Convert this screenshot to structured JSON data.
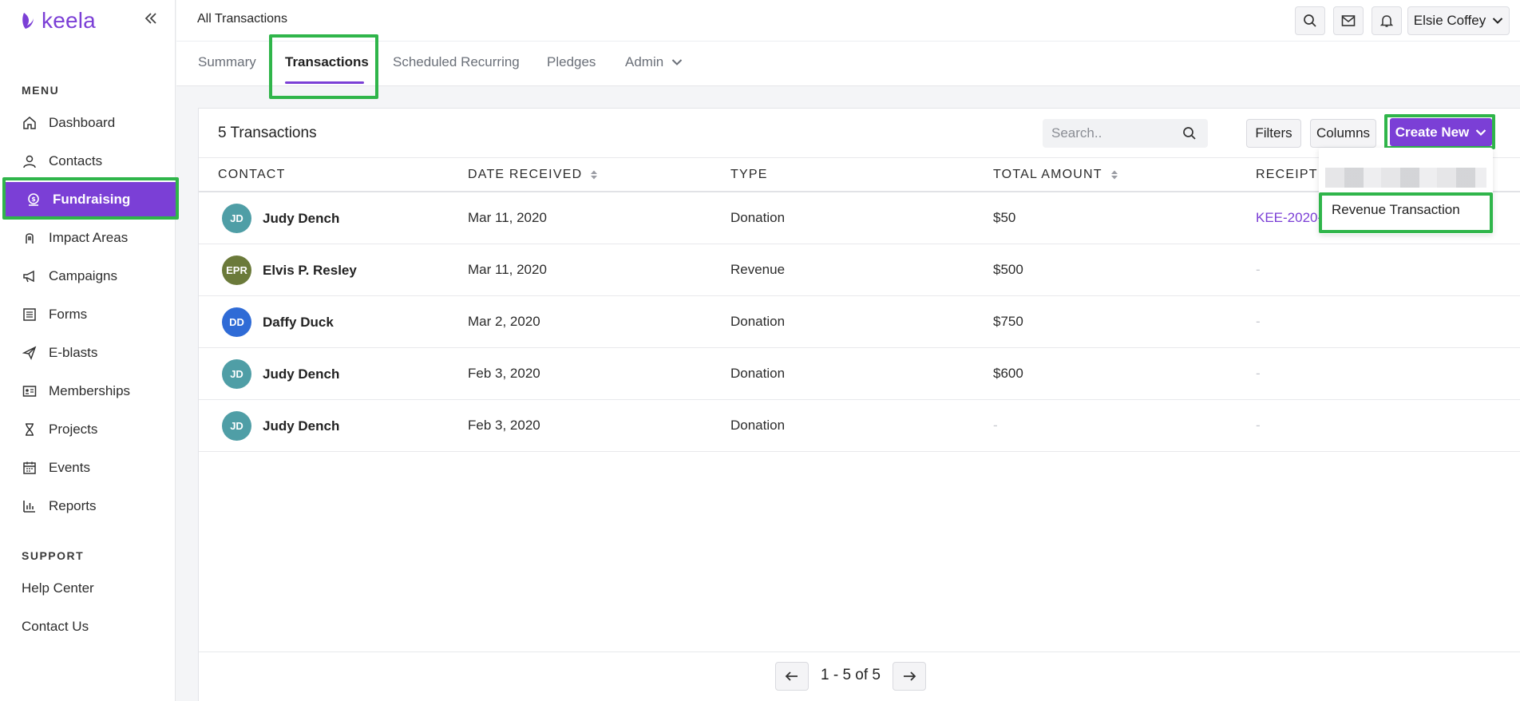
{
  "app": {
    "logo_text": "keela",
    "brand_color": "#7b3fd6",
    "highlight_color": "#2fb54a"
  },
  "sidebar": {
    "menu_label": "MENU",
    "items": [
      {
        "label": "Dashboard",
        "icon": "home-icon"
      },
      {
        "label": "Contacts",
        "icon": "user-icon"
      },
      {
        "label": "Fundraising",
        "icon": "money-icon",
        "active": true
      },
      {
        "label": "Impact Areas",
        "icon": "hand-icon"
      },
      {
        "label": "Campaigns",
        "icon": "megaphone-icon"
      },
      {
        "label": "Forms",
        "icon": "form-icon"
      },
      {
        "label": "E-blasts",
        "icon": "paper-plane-icon"
      },
      {
        "label": "Memberships",
        "icon": "id-card-icon"
      },
      {
        "label": "Projects",
        "icon": "hourglass-icon"
      },
      {
        "label": "Events",
        "icon": "calendar-icon"
      },
      {
        "label": "Reports",
        "icon": "bar-chart-icon"
      }
    ],
    "support_label": "SUPPORT",
    "support_items": [
      {
        "label": "Help Center"
      },
      {
        "label": "Contact Us"
      }
    ]
  },
  "header": {
    "title": "All Transactions",
    "user_name": "Elsie Coffey"
  },
  "tabs": [
    {
      "label": "Summary"
    },
    {
      "label": "Transactions",
      "active": true
    },
    {
      "label": "Scheduled Recurring"
    },
    {
      "label": "Pledges"
    },
    {
      "label": "Admin"
    }
  ],
  "card": {
    "title": "5 Transactions",
    "search_placeholder": "Search..",
    "filters_label": "Filters",
    "columns_label": "Columns",
    "create_label": "Create New"
  },
  "table": {
    "headers": {
      "contact": "CONTACT",
      "date": "DATE RECEIVED",
      "type": "TYPE",
      "amount": "TOTAL AMOUNT",
      "receipt": "RECEIPT"
    },
    "rows": [
      {
        "initials": "JD",
        "avatar_color": "#4f9ea6",
        "name": "Judy Dench",
        "date": "Mar 11, 2020",
        "type": "Donation",
        "amount": "$50",
        "receipt": "KEE-2020-"
      },
      {
        "initials": "EPR",
        "avatar_color": "#6b7a3a",
        "name": "Elvis P. Resley",
        "date": "Mar 11, 2020",
        "type": "Revenue",
        "amount": "$500",
        "receipt": "-"
      },
      {
        "initials": "DD",
        "avatar_color": "#2f6bd6",
        "name": "Daffy Duck",
        "date": "Mar 2, 2020",
        "type": "Donation",
        "amount": "$750",
        "receipt": "-"
      },
      {
        "initials": "JD",
        "avatar_color": "#4f9ea6",
        "name": "Judy Dench",
        "date": "Feb 3, 2020",
        "type": "Donation",
        "amount": "$600",
        "receipt": "-"
      },
      {
        "initials": "JD",
        "avatar_color": "#4f9ea6",
        "name": "Judy Dench",
        "date": "Feb 3, 2020",
        "type": "Donation",
        "amount": "-",
        "receipt": "-"
      }
    ]
  },
  "dropdown": {
    "items": [
      {
        "label": "Revenue Transaction"
      }
    ]
  },
  "pagination": {
    "text": "1 - 5 of 5"
  }
}
